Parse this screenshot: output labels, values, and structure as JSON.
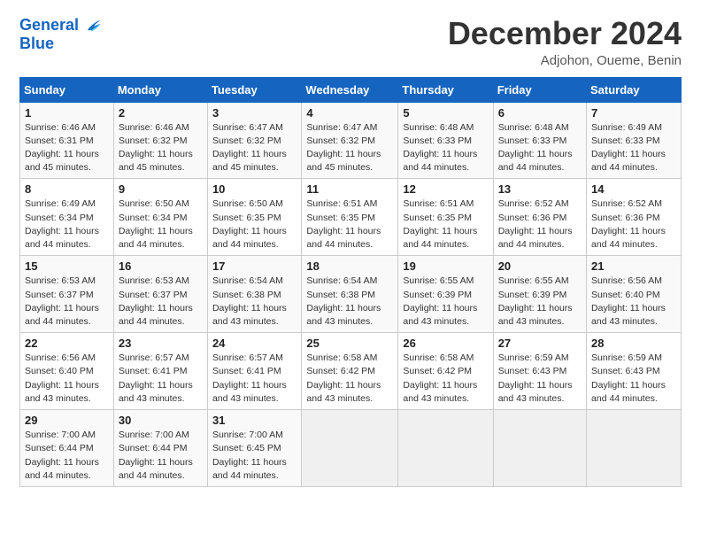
{
  "logo": {
    "line1": "General",
    "line2": "Blue"
  },
  "title": "December 2024",
  "subtitle": "Adjohon, Oueme, Benin",
  "headers": [
    "Sunday",
    "Monday",
    "Tuesday",
    "Wednesday",
    "Thursday",
    "Friday",
    "Saturday"
  ],
  "weeks": [
    [
      {
        "day": "1",
        "info": "Sunrise: 6:46 AM\nSunset: 6:31 PM\nDaylight: 11 hours\nand 45 minutes."
      },
      {
        "day": "2",
        "info": "Sunrise: 6:46 AM\nSunset: 6:32 PM\nDaylight: 11 hours\nand 45 minutes."
      },
      {
        "day": "3",
        "info": "Sunrise: 6:47 AM\nSunset: 6:32 PM\nDaylight: 11 hours\nand 45 minutes."
      },
      {
        "day": "4",
        "info": "Sunrise: 6:47 AM\nSunset: 6:32 PM\nDaylight: 11 hours\nand 45 minutes."
      },
      {
        "day": "5",
        "info": "Sunrise: 6:48 AM\nSunset: 6:33 PM\nDaylight: 11 hours\nand 44 minutes."
      },
      {
        "day": "6",
        "info": "Sunrise: 6:48 AM\nSunset: 6:33 PM\nDaylight: 11 hours\nand 44 minutes."
      },
      {
        "day": "7",
        "info": "Sunrise: 6:49 AM\nSunset: 6:33 PM\nDaylight: 11 hours\nand 44 minutes."
      }
    ],
    [
      {
        "day": "8",
        "info": "Sunrise: 6:49 AM\nSunset: 6:34 PM\nDaylight: 11 hours\nand 44 minutes."
      },
      {
        "day": "9",
        "info": "Sunrise: 6:50 AM\nSunset: 6:34 PM\nDaylight: 11 hours\nand 44 minutes."
      },
      {
        "day": "10",
        "info": "Sunrise: 6:50 AM\nSunset: 6:35 PM\nDaylight: 11 hours\nand 44 minutes."
      },
      {
        "day": "11",
        "info": "Sunrise: 6:51 AM\nSunset: 6:35 PM\nDaylight: 11 hours\nand 44 minutes."
      },
      {
        "day": "12",
        "info": "Sunrise: 6:51 AM\nSunset: 6:35 PM\nDaylight: 11 hours\nand 44 minutes."
      },
      {
        "day": "13",
        "info": "Sunrise: 6:52 AM\nSunset: 6:36 PM\nDaylight: 11 hours\nand 44 minutes."
      },
      {
        "day": "14",
        "info": "Sunrise: 6:52 AM\nSunset: 6:36 PM\nDaylight: 11 hours\nand 44 minutes."
      }
    ],
    [
      {
        "day": "15",
        "info": "Sunrise: 6:53 AM\nSunset: 6:37 PM\nDaylight: 11 hours\nand 44 minutes."
      },
      {
        "day": "16",
        "info": "Sunrise: 6:53 AM\nSunset: 6:37 PM\nDaylight: 11 hours\nand 44 minutes."
      },
      {
        "day": "17",
        "info": "Sunrise: 6:54 AM\nSunset: 6:38 PM\nDaylight: 11 hours\nand 43 minutes."
      },
      {
        "day": "18",
        "info": "Sunrise: 6:54 AM\nSunset: 6:38 PM\nDaylight: 11 hours\nand 43 minutes."
      },
      {
        "day": "19",
        "info": "Sunrise: 6:55 AM\nSunset: 6:39 PM\nDaylight: 11 hours\nand 43 minutes."
      },
      {
        "day": "20",
        "info": "Sunrise: 6:55 AM\nSunset: 6:39 PM\nDaylight: 11 hours\nand 43 minutes."
      },
      {
        "day": "21",
        "info": "Sunrise: 6:56 AM\nSunset: 6:40 PM\nDaylight: 11 hours\nand 43 minutes."
      }
    ],
    [
      {
        "day": "22",
        "info": "Sunrise: 6:56 AM\nSunset: 6:40 PM\nDaylight: 11 hours\nand 43 minutes."
      },
      {
        "day": "23",
        "info": "Sunrise: 6:57 AM\nSunset: 6:41 PM\nDaylight: 11 hours\nand 43 minutes."
      },
      {
        "day": "24",
        "info": "Sunrise: 6:57 AM\nSunset: 6:41 PM\nDaylight: 11 hours\nand 43 minutes."
      },
      {
        "day": "25",
        "info": "Sunrise: 6:58 AM\nSunset: 6:42 PM\nDaylight: 11 hours\nand 43 minutes."
      },
      {
        "day": "26",
        "info": "Sunrise: 6:58 AM\nSunset: 6:42 PM\nDaylight: 11 hours\nand 43 minutes."
      },
      {
        "day": "27",
        "info": "Sunrise: 6:59 AM\nSunset: 6:43 PM\nDaylight: 11 hours\nand 43 minutes."
      },
      {
        "day": "28",
        "info": "Sunrise: 6:59 AM\nSunset: 6:43 PM\nDaylight: 11 hours\nand 44 minutes."
      }
    ],
    [
      {
        "day": "29",
        "info": "Sunrise: 7:00 AM\nSunset: 6:44 PM\nDaylight: 11 hours\nand 44 minutes."
      },
      {
        "day": "30",
        "info": "Sunrise: 7:00 AM\nSunset: 6:44 PM\nDaylight: 11 hours\nand 44 minutes."
      },
      {
        "day": "31",
        "info": "Sunrise: 7:00 AM\nSunset: 6:45 PM\nDaylight: 11 hours\nand 44 minutes."
      },
      {
        "day": "",
        "info": ""
      },
      {
        "day": "",
        "info": ""
      },
      {
        "day": "",
        "info": ""
      },
      {
        "day": "",
        "info": ""
      }
    ]
  ]
}
